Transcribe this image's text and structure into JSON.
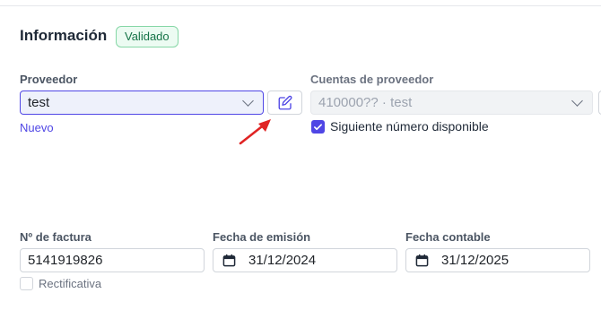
{
  "section": {
    "title": "Información",
    "status_badge": "Validado"
  },
  "proveedor": {
    "label": "Proveedor",
    "selected": "test",
    "new_link": "Nuevo"
  },
  "cuentas": {
    "label": "Cuentas de proveedor",
    "selected": "410000?? · test",
    "checkbox_label": "Siguiente número disponible",
    "checkbox_checked": true
  },
  "factura": {
    "label": "Nº de factura",
    "value": "5141919826",
    "rectificativa_label": "Rectificativa",
    "rectificativa_checked": false
  },
  "fecha_emision": {
    "label": "Fecha de emisión",
    "value": "31/12/2024"
  },
  "fecha_contable": {
    "label": "Fecha contable",
    "value": "31/12/2025"
  },
  "colors": {
    "accent": "#4f46e5",
    "badge_green": "#157347",
    "annotation_arrow": "#e02424"
  },
  "icons": [
    "chevron-down-icon",
    "edit-pencil-icon",
    "check-icon",
    "calendar-icon",
    "red-arrow-annotation"
  ]
}
